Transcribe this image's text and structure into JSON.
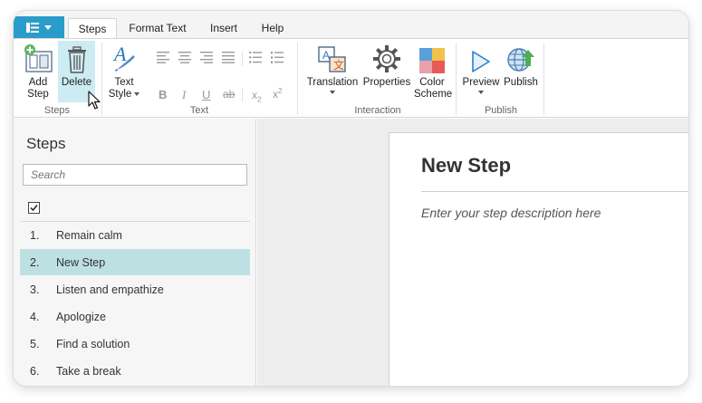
{
  "tabs": [
    {
      "label": "Steps",
      "active": true
    },
    {
      "label": "Format Text",
      "active": false
    },
    {
      "label": "Insert",
      "active": false
    },
    {
      "label": "Help",
      "active": false
    }
  ],
  "ribbon": {
    "steps_group": {
      "label": "Steps",
      "add_step": [
        "Add",
        "Step"
      ],
      "delete": "Delete"
    },
    "text_group": {
      "label": "Text",
      "text_style": [
        "Text",
        "Style"
      ]
    },
    "interaction_group": {
      "label": "Interaction",
      "translation": "Translation",
      "properties": "Properties",
      "color_scheme": [
        "Color",
        "Scheme"
      ]
    },
    "publish_group": {
      "label": "Publish",
      "preview": "Preview",
      "publish": "Publish"
    }
  },
  "steps_panel": {
    "title": "Steps",
    "search_placeholder": "Search",
    "items": [
      {
        "num": "1.",
        "label": "Remain calm",
        "selected": false
      },
      {
        "num": "2.",
        "label": "New Step",
        "selected": true
      },
      {
        "num": "3.",
        "label": "Listen and empathize",
        "selected": false
      },
      {
        "num": "4.",
        "label": "Apologize",
        "selected": false
      },
      {
        "num": "5.",
        "label": "Find a solution",
        "selected": false
      },
      {
        "num": "6.",
        "label": "Take a break",
        "selected": false
      }
    ]
  },
  "editor": {
    "title": "New Step",
    "description_placeholder": "Enter your step description here"
  },
  "colors": {
    "accent": "#2a9cc9",
    "selected_row": "#bde0e3",
    "hover_button": "#cdebf3"
  }
}
